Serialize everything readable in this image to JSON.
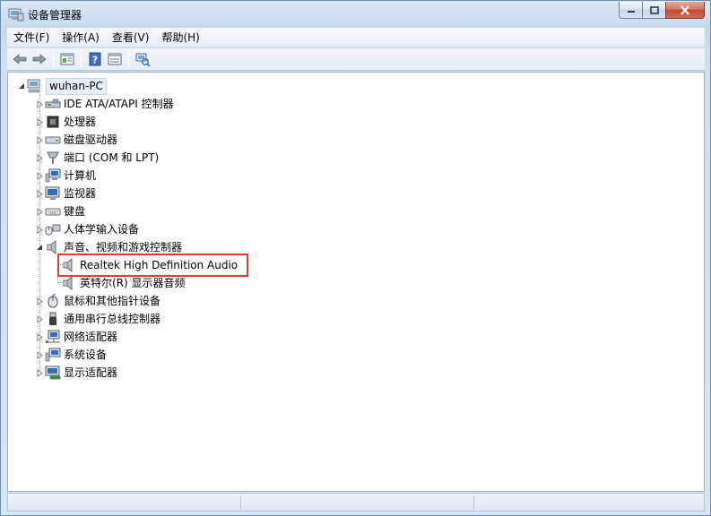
{
  "window": {
    "title": "设备管理器"
  },
  "menu": [
    {
      "label": "文件(F)"
    },
    {
      "label": "操作(A)"
    },
    {
      "label": "查看(V)"
    },
    {
      "label": "帮助(H)"
    }
  ],
  "toolbar": {
    "buttons": [
      "back-icon",
      "forward-icon",
      "show-hide-console-tree-icon",
      "help-icon",
      "properties-icon",
      "scan-hardware-icon"
    ]
  },
  "tree": {
    "root": {
      "label": "wuhan-PC",
      "icon": "computer-icon",
      "expanded": true
    },
    "categories": [
      {
        "label": "IDE ATA/ATAPI 控制器",
        "icon": "ide-controller-icon",
        "expanded": false
      },
      {
        "label": "处理器",
        "icon": "processor-icon",
        "expanded": false
      },
      {
        "label": "磁盘驱动器",
        "icon": "disk-drive-icon",
        "expanded": false
      },
      {
        "label": "端口 (COM 和 LPT)",
        "icon": "port-icon",
        "expanded": false
      },
      {
        "label": "计算机",
        "icon": "computer-category-icon",
        "expanded": false
      },
      {
        "label": "监视器",
        "icon": "monitor-icon",
        "expanded": false
      },
      {
        "label": "键盘",
        "icon": "keyboard-icon",
        "expanded": false
      },
      {
        "label": "人体学输入设备",
        "icon": "hid-icon",
        "expanded": false
      },
      {
        "label": "声音、视频和游戏控制器",
        "icon": "speaker-icon",
        "expanded": true,
        "children": [
          {
            "label": "Realtek High Definition Audio",
            "icon": "speaker-icon",
            "highlighted": true
          },
          {
            "label": "英特尔(R) 显示器音频",
            "icon": "speaker-icon",
            "highlighted": false
          }
        ]
      },
      {
        "label": "鼠标和其他指针设备",
        "icon": "mouse-icon",
        "expanded": false
      },
      {
        "label": "通用串行总线控制器",
        "icon": "usb-icon",
        "expanded": false
      },
      {
        "label": "网络适配器",
        "icon": "network-adapter-icon",
        "expanded": false
      },
      {
        "label": "系统设备",
        "icon": "system-device-icon",
        "expanded": false
      },
      {
        "label": "显示适配器",
        "icon": "display-adapter-icon",
        "expanded": false
      }
    ]
  },
  "colors": {
    "highlight_border": "#d8403a",
    "close_button": "#c24c33"
  }
}
